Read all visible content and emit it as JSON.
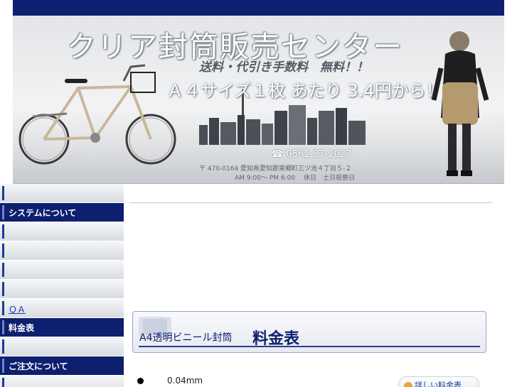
{
  "banner": {
    "title": "クリア封筒販売センター",
    "sub1": "送料・代引き手数料　無料！！",
    "sub2": "Ａ４サイズ１枚 あたり 3.4円から！",
    "phone": "☎ 0561-37-2027",
    "address": "〒 470-0164 愛知県愛知郡東郷町三ツ池４丁目５-２",
    "hours": "AM 9:00～ PM 6:00　 休日　土日祝祭日"
  },
  "sidebar": {
    "items": [
      {
        "label": "",
        "style": "light"
      },
      {
        "label": "システムについて",
        "style": "dark"
      },
      {
        "label": "",
        "style": "light"
      },
      {
        "label": "",
        "style": "light"
      },
      {
        "label": "",
        "style": "light"
      },
      {
        "label": "",
        "style": "light"
      },
      {
        "label": "ＱＡ",
        "style": "light"
      },
      {
        "label": "料金表",
        "style": "dark"
      },
      {
        "label": "",
        "style": "light"
      },
      {
        "label": "ご注文について",
        "style": "dark"
      },
      {
        "label": "",
        "style": "light"
      }
    ]
  },
  "main": {
    "heading_sub": "A4透明ビニール封筒",
    "heading_main": "料金表",
    "spec_value": "0.04mm",
    "detail_button": "詳しい料金表"
  },
  "colors": {
    "navy": "#0d1f6e",
    "link": "#1a3aa8"
  }
}
